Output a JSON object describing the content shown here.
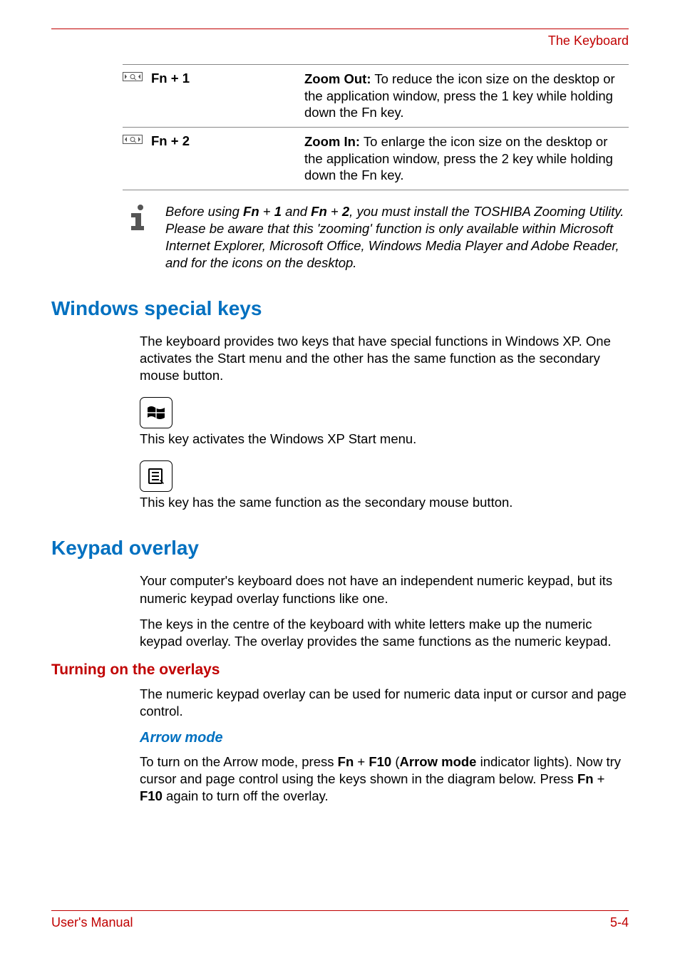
{
  "header": {
    "title": "The Keyboard"
  },
  "table": {
    "rows": [
      {
        "label_pre": "Fn",
        "label_mid": " + ",
        "label_post": "1",
        "desc_bold": "Zoom Out:",
        "desc_rest": " To reduce the icon size on the desktop or the application window, press the 1 key while holding down the Fn key."
      },
      {
        "label_pre": "Fn",
        "label_mid": " + ",
        "label_post": "2",
        "desc_bold": "Zoom In:",
        "desc_rest": " To enlarge the icon size on the desktop or the application window, press the 2 key while holding down the Fn key."
      }
    ]
  },
  "note": {
    "pre": "Before using ",
    "b1": "Fn",
    "m1": " + ",
    "b2": "1",
    "m2": " and ",
    "b3": "Fn",
    "m3": " + ",
    "b4": "2",
    "post": ", you must install the TOSHIBA Zooming Utility. Please be aware that this 'zooming' function is only available within Microsoft Internet Explorer, Microsoft Office, Windows Media Player and Adobe Reader, and for the icons on the desktop."
  },
  "section1": {
    "title": "Windows special keys",
    "p1": "The keyboard provides two keys that have special functions in Windows XP. One activates the Start menu and the other has the same function as the secondary mouse button.",
    "key1_caption": "This key activates the Windows XP Start menu.",
    "key2_caption": "This key has the same function as the secondary mouse button."
  },
  "section2": {
    "title": "Keypad overlay",
    "p1": "Your computer's keyboard does not have an independent numeric keypad, but its numeric keypad overlay functions like one.",
    "p2": "The keys in the centre of the keyboard with white letters make up the numeric keypad overlay. The overlay provides the same functions as the numeric keypad."
  },
  "section3": {
    "title": "Turning on the overlays",
    "p1": "The numeric keypad overlay can be used for numeric data input or cursor and page control."
  },
  "arrow": {
    "title": "Arrow mode",
    "pre": "To turn on the Arrow mode, press ",
    "b1": "Fn",
    "m1": " + ",
    "b2": "F10",
    "m2": " (",
    "b3": "Arrow mode",
    "m3": " indicator lights). Now try cursor and page control using the keys shown in the diagram below. Press ",
    "b4": "Fn",
    "m4": " + ",
    "b5": "F10",
    "post": " again to turn off the overlay."
  },
  "footer": {
    "left": "User's Manual",
    "right": "5-4"
  }
}
